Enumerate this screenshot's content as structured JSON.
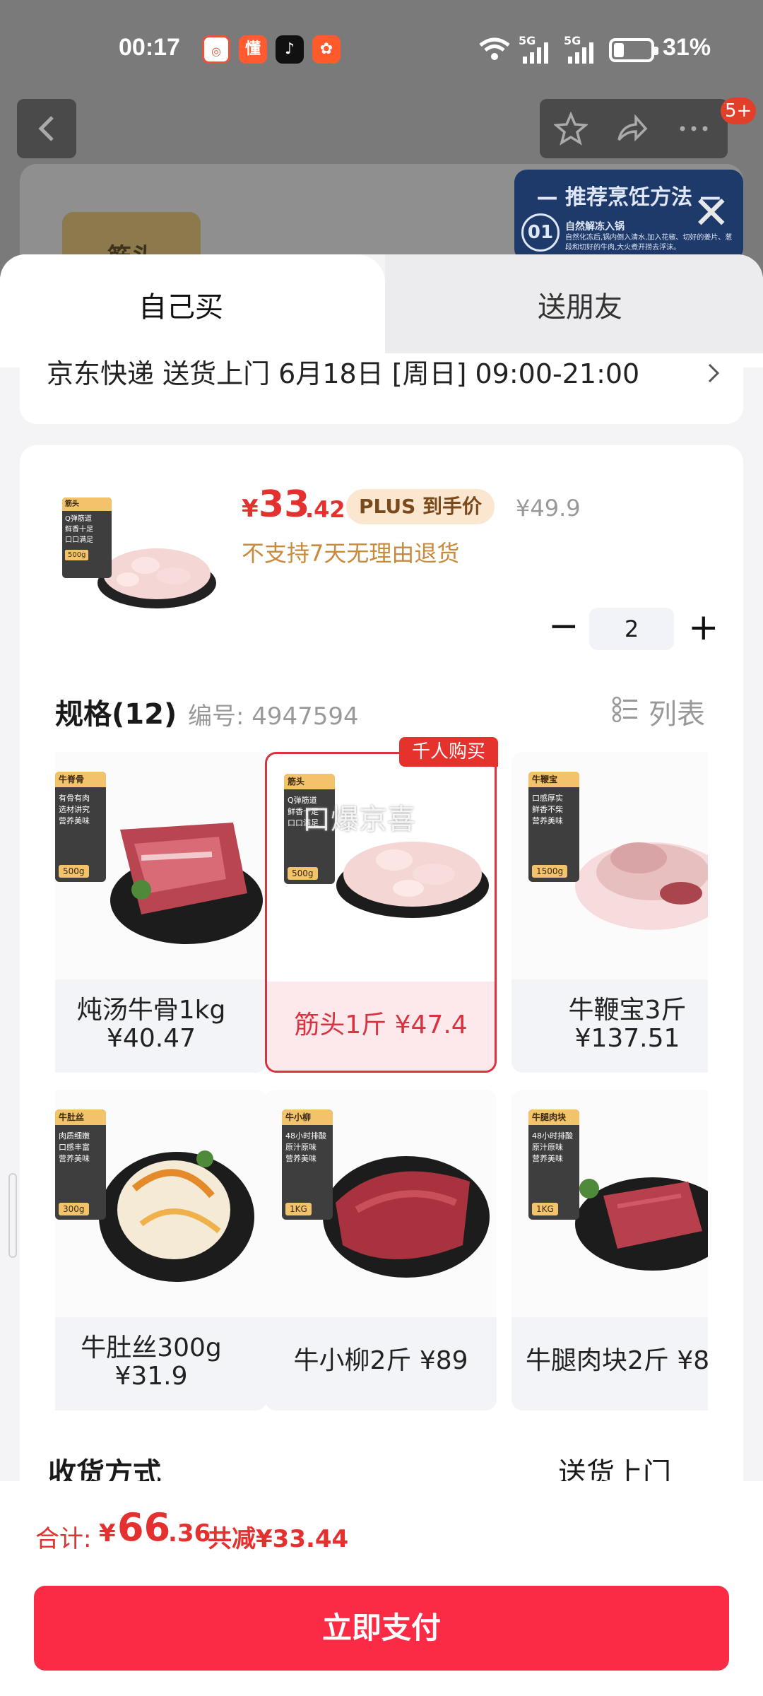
{
  "status_bar": {
    "time": "00:17",
    "app_icons": [
      "app-icon-1",
      "懂",
      "app-icon-tiktok",
      "app-icon-4"
    ],
    "network": "5G",
    "battery": "31%"
  },
  "top_nav": {
    "back_icon": "chevron-left-icon",
    "favorite_icon": "star-icon",
    "share_icon": "share-icon",
    "more_icon": "more-icon",
    "badge": "5+"
  },
  "background_page": {
    "tag_text": "筋头",
    "recipe_title": "— 推荐烹饪方法 —",
    "recipe_step_no": "01",
    "recipe_step_title": "自然解冻入锅",
    "recipe_step_desc": "自然化冻后,锅内倒入清水,加入花椒、切好的姜片、葱段和切好的牛肉,大火煮开捞去浮沫。"
  },
  "sheet": {
    "tabs": [
      {
        "label": "自己买",
        "active": true
      },
      {
        "label": "送朋友",
        "active": false
      }
    ],
    "delivery_text": "京东快递 送货上门 6月18日 [周日] 09:00-21:00"
  },
  "product": {
    "thumb_tag": "筋头",
    "thumb_bullets": [
      "Q弹筋道",
      "鲜香十足",
      "口口满足"
    ],
    "thumb_weight": "500g",
    "price_symbol": "¥",
    "price_int": "33",
    "price_dec": ".42",
    "plus_label": "PLUS 到手价",
    "original_price": "¥49.9",
    "return_policy": "不支持7天无理由退货",
    "quantity": "2",
    "minus_label": "−",
    "plus_btn_label": "+"
  },
  "spec": {
    "title": "规格(12)",
    "code": "编号: 4947594",
    "view_toggle": "列表",
    "hot_tag": "千人购买",
    "watermark": "口爆京喜",
    "items": [
      {
        "name_line1": "炖汤牛骨1kg",
        "name_line2": "¥40.47",
        "pkg_name": "牛脊骨",
        "pkg_bullets": [
          "有骨有肉",
          "选材讲究",
          "营养美味"
        ],
        "pkg_weight": "500g",
        "selected": false
      },
      {
        "name_line1": "筋头1斤 ¥47.4",
        "name_line2": "",
        "pkg_name": "筋头",
        "pkg_bullets": [
          "Q弹筋道",
          "鲜香十足",
          "口口满足"
        ],
        "pkg_weight": "500g",
        "selected": true
      },
      {
        "name_line1": "牛鞭宝3斤",
        "name_line2": "¥137.51",
        "pkg_name": "牛鞭宝",
        "pkg_bullets": [
          "口感厚实",
          "鲜香不柴",
          "营养美味"
        ],
        "pkg_weight": "1500g",
        "selected": false
      },
      {
        "name_line1": "牛肚丝300g",
        "name_line2": "¥31.9",
        "pkg_name": "牛肚丝",
        "pkg_bullets": [
          "肉质细嫩",
          "口感丰富",
          "营养美味"
        ],
        "pkg_weight": "300g",
        "selected": false
      },
      {
        "name_line1": "牛小柳2斤 ¥89",
        "name_line2": "",
        "pkg_name": "牛小柳",
        "pkg_bullets": [
          "48小时排酸",
          "原汁原味",
          "营养美味"
        ],
        "pkg_weight": "1KG",
        "selected": false
      },
      {
        "name_line1": "牛腿肉块2斤 ¥8",
        "name_line2": "",
        "pkg_name": "牛腿肉块",
        "pkg_bullets": [
          "48小时排酸",
          "原汁原味",
          "营养美味"
        ],
        "pkg_weight": "1KG",
        "selected": false
      }
    ]
  },
  "receive": {
    "label": "收货方式",
    "value": "送货上门"
  },
  "footer": {
    "total_label": "合计:",
    "total_symbol": "¥",
    "total_int": "66",
    "total_dec": ".36",
    "saved": "共减¥33.44",
    "pay_button": "立即支付"
  },
  "colors": {
    "accent_red": "#e4302e",
    "pay_button": "#fb2a45",
    "plus_tag_bg": "#fbe7d0"
  }
}
